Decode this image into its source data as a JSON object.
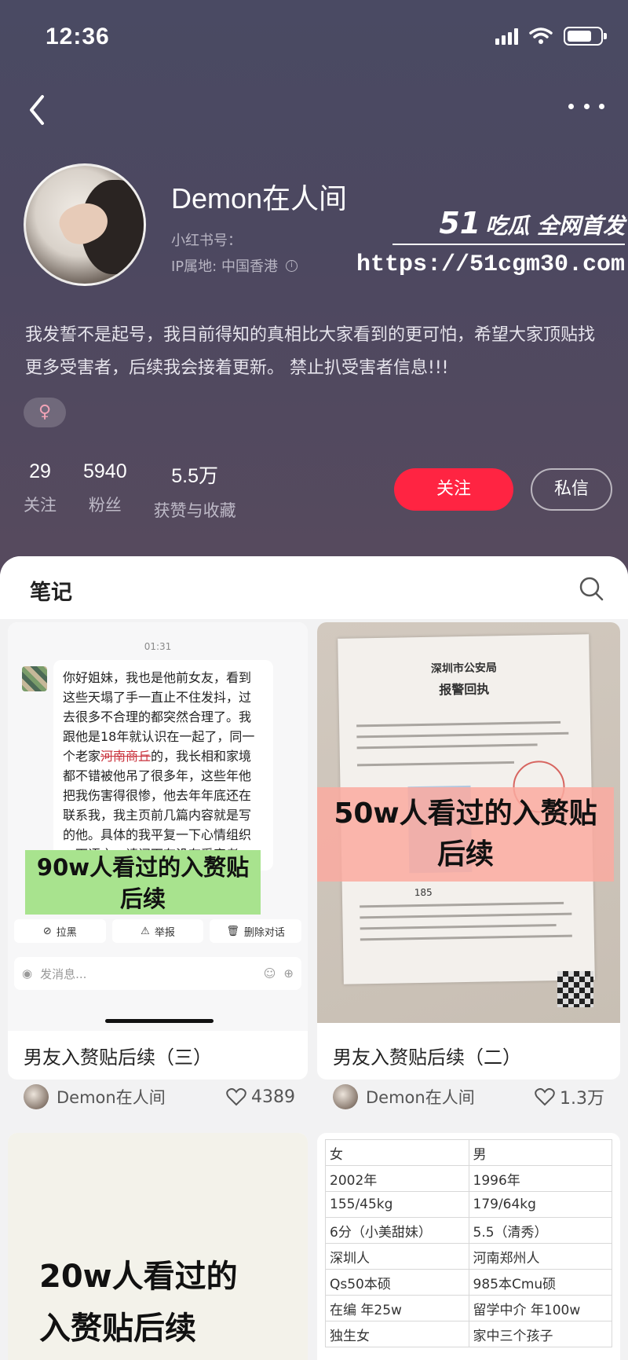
{
  "status_bar": {
    "time": "12:36"
  },
  "profile": {
    "name": "Demon在人间",
    "redbook_id_label": "小红书号：",
    "ip_location": "IP属地: 中国香港",
    "bio": "我发誓不是起号，我目前得知的真相比大家看到的更可怕，希望大家顶贴找更多受害者，后续我会接着更新。 禁止扒受害者信息!!!",
    "gender_symbol": "♀"
  },
  "watermark": {
    "logo": "51",
    "slogan": "吃瓜 全网首发",
    "url": "https://51cgm30.com"
  },
  "stats": [
    {
      "value": "29",
      "label": "关注"
    },
    {
      "value": "5940",
      "label": "粉丝"
    },
    {
      "value": "5.5万",
      "label": "获赞与收藏"
    }
  ],
  "actions": {
    "follow": "关注",
    "message": "私信"
  },
  "tabs": {
    "notes": "笔记"
  },
  "cards": [
    {
      "title": "男友入赘贴后续（三）",
      "author": "Demon在人间",
      "likes": "4389",
      "chat": {
        "time": "01:31",
        "bubble_lines": [
          "你好姐妹，我也是他前女友，看到",
          "这些天塌了手一直止不住发抖，过",
          "去很多不合理的都突然合理了。我",
          "跟他是18年就认识在一起了，同一",
          "个老家",
          "的，我长相和家境",
          "都不错被他吊了很多年，这些年他",
          "把我伤害得很惨，他去年年底还在",
          "联系我，我主页前几篇内容就是写",
          "的他。具体的我平复一下心情组织",
          "一下语言，请问下有没有受害者"
        ],
        "struck_text": "河南商丘",
        "overlay_line1": "90w人看过的入赘贴",
        "overlay_line2": "后续",
        "action_block": "拉黑",
        "action_report": "举报",
        "action_delete": "删除对话",
        "input_placeholder": "发消息..."
      }
    },
    {
      "title": "男友入赘贴后续（二）",
      "author": "Demon在人间",
      "likes": "1.3万",
      "doc": {
        "heading": "深圳市公安局",
        "subheading": "报警回执",
        "overlay_line1": "50w人看过的入赘贴",
        "overlay_line2": "后续",
        "partial_number": "185"
      }
    },
    {
      "overlay_line1": "20w人看过的",
      "overlay_line2": "入赘贴后续"
    },
    {
      "table": [
        [
          "女",
          "男"
        ],
        [
          "2002年",
          "1996年"
        ],
        [
          "155/45kg",
          "179/64kg"
        ],
        [
          "6分（小美甜妹）",
          "5.5（清秀）"
        ],
        [
          "深圳人",
          "河南郑州人"
        ],
        [
          "Qs50本硕",
          "985本Cmu硕"
        ],
        [
          "在编 年25w",
          "留学中介 年100w"
        ],
        [
          "独生女",
          "家中三个孩子"
        ]
      ]
    }
  ],
  "colors": {
    "accent": "#ff2442",
    "header_bg": "#4c4860"
  }
}
